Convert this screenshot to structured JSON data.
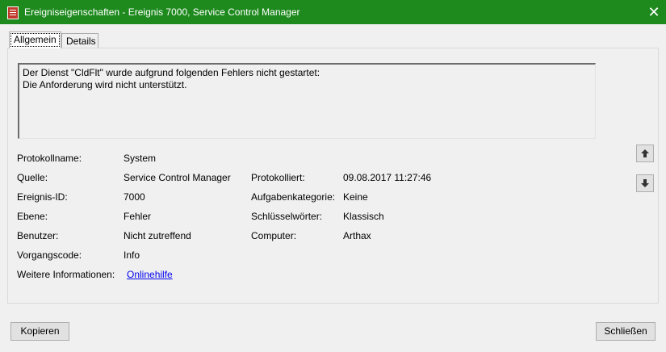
{
  "window": {
    "title": "Ereigniseigenschaften - Ereignis 7000, Service Control Manager",
    "icon": "event-viewer-icon",
    "close_glyph": "✕",
    "accent": "#1e8a1e"
  },
  "tabs": [
    {
      "label": "Allgemein",
      "active": true
    },
    {
      "label": "Details",
      "active": false
    }
  ],
  "message": {
    "line1": "Der Dienst \"CldFlt\" wurde aufgrund folgenden Fehlers nicht gestartet:",
    "line2": "Die Anforderung wird nicht unterstützt."
  },
  "fields": {
    "protokollname": {
      "label": "Protokollname:",
      "value": "System"
    },
    "quelle": {
      "label": "Quelle:",
      "value": "Service Control Manager"
    },
    "protokolliert": {
      "label": "Protokolliert:",
      "value": "09.08.2017 11:27:46"
    },
    "ereignis_id": {
      "label": "Ereignis-ID:",
      "value": "7000"
    },
    "aufgabenkategorie": {
      "label": "Aufgabenkategorie:",
      "value": "Keine"
    },
    "ebene": {
      "label": "Ebene:",
      "value": "Fehler"
    },
    "schluesselwoerter": {
      "label": "Schlüsselwörter:",
      "value": "Klassisch"
    },
    "benutzer": {
      "label": "Benutzer:",
      "value": "Nicht zutreffend"
    },
    "computer": {
      "label": "Computer:",
      "value": "Arthax"
    },
    "vorgangscode": {
      "label": "Vorgangscode:",
      "value": "Info"
    },
    "weitere": {
      "label": "Weitere Informationen:",
      "link": "Onlinehilfe"
    }
  },
  "buttons": {
    "kopieren": "Kopieren",
    "schliessen": "Schließen",
    "up_icon": "arrow-up-icon",
    "down_icon": "arrow-down-icon"
  }
}
